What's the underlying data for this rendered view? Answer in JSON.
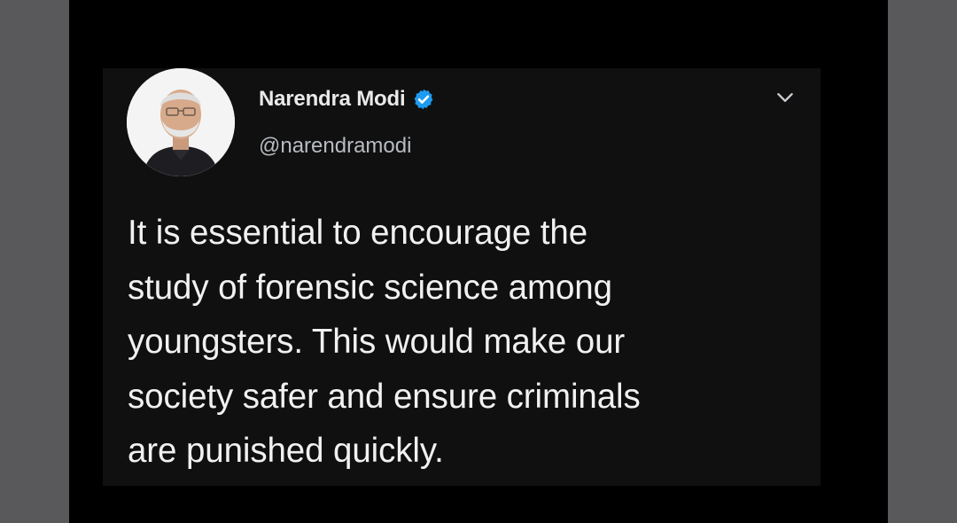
{
  "tweet": {
    "display_name": "Narendra Modi",
    "handle": "@narendramodi",
    "verified": true,
    "text_lines": [
      "It is essential to encourage the",
      "study of forensic science among",
      "youngsters. This would make our",
      "society safer and ensure criminals",
      "are punished quickly."
    ]
  },
  "icons": {
    "verified": "verified-badge-icon",
    "menu": "chevron-down-icon"
  },
  "colors": {
    "background": "#000000",
    "card": "#101011",
    "verified_blue": "#1d9bf0",
    "text": "#f1f1f2",
    "handle": "#b8bcc0"
  }
}
